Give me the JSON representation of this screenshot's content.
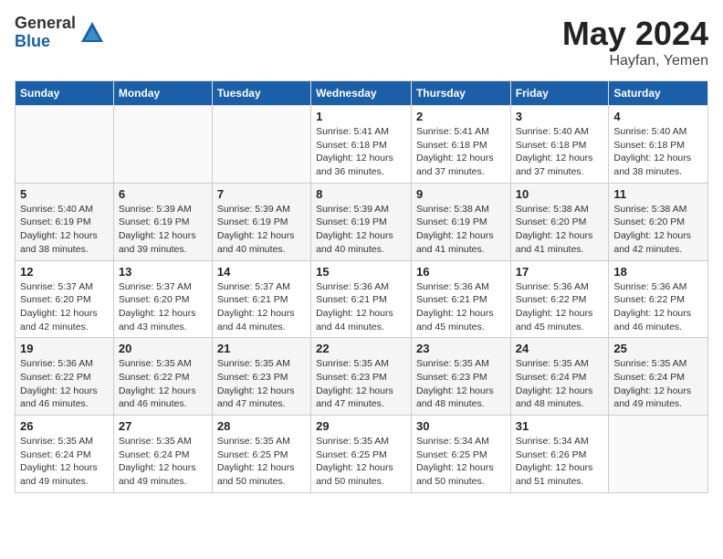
{
  "logo": {
    "general": "General",
    "blue": "Blue"
  },
  "title": {
    "month": "May 2024",
    "location": "Hayfan, Yemen"
  },
  "headers": [
    "Sunday",
    "Monday",
    "Tuesday",
    "Wednesday",
    "Thursday",
    "Friday",
    "Saturday"
  ],
  "weeks": [
    [
      {
        "day": "",
        "info": ""
      },
      {
        "day": "",
        "info": ""
      },
      {
        "day": "",
        "info": ""
      },
      {
        "day": "1",
        "info": "Sunrise: 5:41 AM\nSunset: 6:18 PM\nDaylight: 12 hours\nand 36 minutes."
      },
      {
        "day": "2",
        "info": "Sunrise: 5:41 AM\nSunset: 6:18 PM\nDaylight: 12 hours\nand 37 minutes."
      },
      {
        "day": "3",
        "info": "Sunrise: 5:40 AM\nSunset: 6:18 PM\nDaylight: 12 hours\nand 37 minutes."
      },
      {
        "day": "4",
        "info": "Sunrise: 5:40 AM\nSunset: 6:18 PM\nDaylight: 12 hours\nand 38 minutes."
      }
    ],
    [
      {
        "day": "5",
        "info": "Sunrise: 5:40 AM\nSunset: 6:19 PM\nDaylight: 12 hours\nand 38 minutes."
      },
      {
        "day": "6",
        "info": "Sunrise: 5:39 AM\nSunset: 6:19 PM\nDaylight: 12 hours\nand 39 minutes."
      },
      {
        "day": "7",
        "info": "Sunrise: 5:39 AM\nSunset: 6:19 PM\nDaylight: 12 hours\nand 40 minutes."
      },
      {
        "day": "8",
        "info": "Sunrise: 5:39 AM\nSunset: 6:19 PM\nDaylight: 12 hours\nand 40 minutes."
      },
      {
        "day": "9",
        "info": "Sunrise: 5:38 AM\nSunset: 6:19 PM\nDaylight: 12 hours\nand 41 minutes."
      },
      {
        "day": "10",
        "info": "Sunrise: 5:38 AM\nSunset: 6:20 PM\nDaylight: 12 hours\nand 41 minutes."
      },
      {
        "day": "11",
        "info": "Sunrise: 5:38 AM\nSunset: 6:20 PM\nDaylight: 12 hours\nand 42 minutes."
      }
    ],
    [
      {
        "day": "12",
        "info": "Sunrise: 5:37 AM\nSunset: 6:20 PM\nDaylight: 12 hours\nand 42 minutes."
      },
      {
        "day": "13",
        "info": "Sunrise: 5:37 AM\nSunset: 6:20 PM\nDaylight: 12 hours\nand 43 minutes."
      },
      {
        "day": "14",
        "info": "Sunrise: 5:37 AM\nSunset: 6:21 PM\nDaylight: 12 hours\nand 44 minutes."
      },
      {
        "day": "15",
        "info": "Sunrise: 5:36 AM\nSunset: 6:21 PM\nDaylight: 12 hours\nand 44 minutes."
      },
      {
        "day": "16",
        "info": "Sunrise: 5:36 AM\nSunset: 6:21 PM\nDaylight: 12 hours\nand 45 minutes."
      },
      {
        "day": "17",
        "info": "Sunrise: 5:36 AM\nSunset: 6:22 PM\nDaylight: 12 hours\nand 45 minutes."
      },
      {
        "day": "18",
        "info": "Sunrise: 5:36 AM\nSunset: 6:22 PM\nDaylight: 12 hours\nand 46 minutes."
      }
    ],
    [
      {
        "day": "19",
        "info": "Sunrise: 5:36 AM\nSunset: 6:22 PM\nDaylight: 12 hours\nand 46 minutes."
      },
      {
        "day": "20",
        "info": "Sunrise: 5:35 AM\nSunset: 6:22 PM\nDaylight: 12 hours\nand 46 minutes."
      },
      {
        "day": "21",
        "info": "Sunrise: 5:35 AM\nSunset: 6:23 PM\nDaylight: 12 hours\nand 47 minutes."
      },
      {
        "day": "22",
        "info": "Sunrise: 5:35 AM\nSunset: 6:23 PM\nDaylight: 12 hours\nand 47 minutes."
      },
      {
        "day": "23",
        "info": "Sunrise: 5:35 AM\nSunset: 6:23 PM\nDaylight: 12 hours\nand 48 minutes."
      },
      {
        "day": "24",
        "info": "Sunrise: 5:35 AM\nSunset: 6:24 PM\nDaylight: 12 hours\nand 48 minutes."
      },
      {
        "day": "25",
        "info": "Sunrise: 5:35 AM\nSunset: 6:24 PM\nDaylight: 12 hours\nand 49 minutes."
      }
    ],
    [
      {
        "day": "26",
        "info": "Sunrise: 5:35 AM\nSunset: 6:24 PM\nDaylight: 12 hours\nand 49 minutes."
      },
      {
        "day": "27",
        "info": "Sunrise: 5:35 AM\nSunset: 6:24 PM\nDaylight: 12 hours\nand 49 minutes."
      },
      {
        "day": "28",
        "info": "Sunrise: 5:35 AM\nSunset: 6:25 PM\nDaylight: 12 hours\nand 50 minutes."
      },
      {
        "day": "29",
        "info": "Sunrise: 5:35 AM\nSunset: 6:25 PM\nDaylight: 12 hours\nand 50 minutes."
      },
      {
        "day": "30",
        "info": "Sunrise: 5:34 AM\nSunset: 6:25 PM\nDaylight: 12 hours\nand 50 minutes."
      },
      {
        "day": "31",
        "info": "Sunrise: 5:34 AM\nSunset: 6:26 PM\nDaylight: 12 hours\nand 51 minutes."
      },
      {
        "day": "",
        "info": ""
      }
    ]
  ]
}
